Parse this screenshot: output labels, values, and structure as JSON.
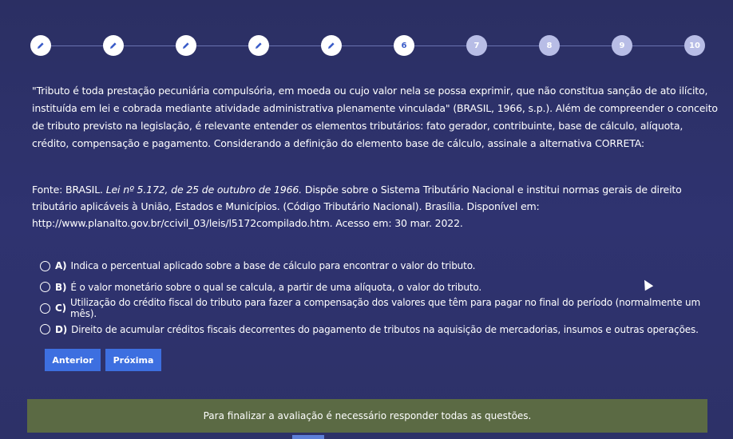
{
  "stepper": {
    "steps": [
      {
        "label": "",
        "state": "done",
        "icon": "pencil-icon"
      },
      {
        "label": "",
        "state": "done",
        "icon": "pencil-icon"
      },
      {
        "label": "",
        "state": "done",
        "icon": "pencil-icon"
      },
      {
        "label": "",
        "state": "done",
        "icon": "pencil-icon"
      },
      {
        "label": "",
        "state": "done",
        "icon": "pencil-icon"
      },
      {
        "label": "6",
        "state": "current"
      },
      {
        "label": "7",
        "state": "todo"
      },
      {
        "label": "8",
        "state": "todo"
      },
      {
        "label": "9",
        "state": "todo"
      },
      {
        "label": "10",
        "state": "todo"
      }
    ]
  },
  "question": {
    "text": "\"Tributo é toda prestação pecuniária compulsória, em moeda ou cujo valor nela se possa exprimir, que não constitua sanção de ato ilícito, instituída em lei e cobrada mediante atividade administrativa plenamente vinculada\" (BRASIL, 1966, s.p.). Além de compreender o conceito de tributo previsto na legislação, é relevante entender os elementos tributários: fato gerador, contribuinte, base de cálculo, alíquota, crédito, compensação e pagamento. Considerando a definição do elemento base de cálculo, assinale a alternativa CORRETA:"
  },
  "source": {
    "prefix": "Fonte: BRASIL. ",
    "italic": "Lei nº 5.172, de 25 de outubro de 1966.",
    "rest": " Dispõe sobre o Sistema Tributário Nacional e institui normas gerais de direito tributário aplicáveis à União, Estados e Municípios. (Código Tributário Nacional). Brasília. Disponível em: http://www.planalto.gov.br/ccivil_03/leis/l5172compilado.htm. Acesso em: 30 mar. 2022."
  },
  "options": [
    {
      "letter": "A)",
      "text": "Indica o percentual aplicado sobre a base de cálculo para encontrar o valor do tributo."
    },
    {
      "letter": "B)",
      "text": "É o valor monetário sobre o qual se calcula, a partir de uma alíquota, o valor do tributo."
    },
    {
      "letter": "C)",
      "text": "Utilização do crédito fiscal do tributo para fazer a compensação dos valores que têm para pagar no final do período (normalmente um mês)."
    },
    {
      "letter": "D)",
      "text": "Direito de acumular créditos fiscais decorrentes do pagamento de tributos na aquisição de mercadorias, insumos e outras operações."
    }
  ],
  "buttons": {
    "prev": "Anterior",
    "next": "Próxima"
  },
  "notice": {
    "text": "Para finalizar a avaliação é necessário responder todas as questões."
  },
  "colors": {
    "background": "#2f3370",
    "button": "#3d6fe0",
    "notice": "#5b6a44"
  }
}
